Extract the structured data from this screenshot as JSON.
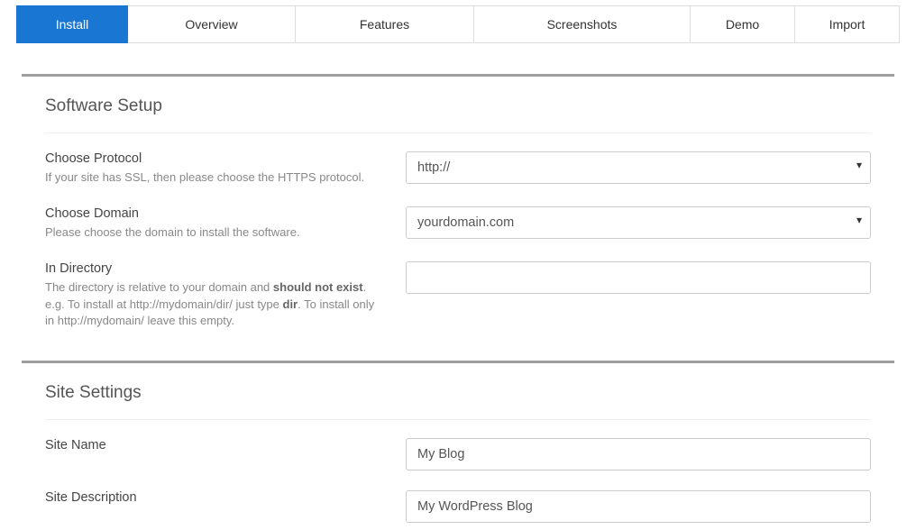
{
  "tabs": {
    "install": {
      "label": "Install",
      "active": true
    },
    "overview": {
      "label": "Overview",
      "active": false
    },
    "features": {
      "label": "Features",
      "active": false
    },
    "screenshots": {
      "label": "Screenshots",
      "active": false
    },
    "demo": {
      "label": "Demo",
      "active": false
    },
    "import": {
      "label": "Import",
      "active": false
    }
  },
  "sections": {
    "software_setup": {
      "title": "Software Setup",
      "fields": {
        "protocol": {
          "label": "Choose Protocol",
          "help": "If your site has SSL, then please choose the HTTPS protocol.",
          "value": "http://"
        },
        "domain": {
          "label": "Choose Domain",
          "help": "Please choose the domain to install the software.",
          "value": "yourdomain.com"
        },
        "directory": {
          "label": "In Directory",
          "help_pre": "The directory is relative to your domain and ",
          "help_strong1": "should not exist",
          "help_mid": ". e.g. To install at http://mydomain/dir/ just type ",
          "help_strong2": "dir",
          "help_post": ". To install only in http://mydomain/ leave this empty.",
          "value": ""
        }
      }
    },
    "site_settings": {
      "title": "Site Settings",
      "fields": {
        "site_name": {
          "label": "Site Name",
          "value": "My Blog"
        },
        "site_description": {
          "label": "Site Description",
          "value": "My WordPress Blog"
        }
      }
    }
  }
}
